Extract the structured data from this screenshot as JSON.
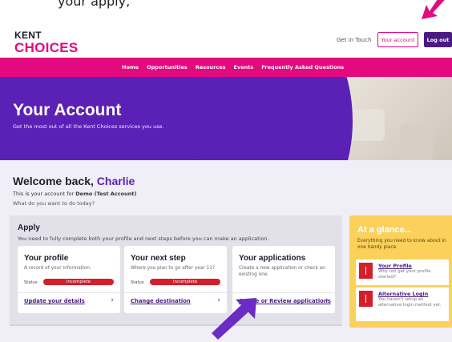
{
  "clipped_text": "your apply,",
  "header": {
    "logo_line1": "KENT",
    "logo_line2": "CHOICES",
    "get_in_touch": "Get in Touch",
    "your_account": "Your account",
    "log_out": "Log out"
  },
  "nav": {
    "items": [
      "Home",
      "Opportunities",
      "Resources",
      "Events",
      "Frequently Asked Questions"
    ]
  },
  "hero": {
    "title": "Your Account",
    "subtitle": "Get the most out of all the Kent Choices services you use."
  },
  "welcome": {
    "prefix": "Welcome back, ",
    "name": "Charlie",
    "account_prefix": "This is your account for ",
    "account_name": "Demo (Test Account)",
    "question": "What do you want to do today?"
  },
  "apply": {
    "title": "Apply",
    "description": "You need to fully complete both your profile and next steps before you can make an application.",
    "cards": [
      {
        "title": "Your profile",
        "description": "A record of your information.",
        "status_label": "Status",
        "status_value": "Incomplete",
        "link": "Update your details"
      },
      {
        "title": "Your next step",
        "description": "Where you plan to go after year 11?",
        "status_label": "Status",
        "status_value": "Incomplete",
        "link": "Change destination"
      },
      {
        "title": "Your applications",
        "description": "Create a new application or check an existing one.",
        "link": "Create or Review applications"
      }
    ]
  },
  "glance": {
    "title": "At a glance...",
    "description": "Everything you need to know about in one handy place.",
    "items": [
      {
        "link": "Your Profile",
        "text": "Why not get your profile started?"
      },
      {
        "link": "Alternative Login",
        "text": "You haven't setup an alternative login method yet."
      }
    ]
  },
  "colors": {
    "brand_pink": "#e3097f",
    "brand_purple": "#5b21b6",
    "status_red": "#d31f2b",
    "glance_yellow": "#fbd15b",
    "arrow_top": "#e3097f",
    "arrow_bottom": "#6b2bc4"
  },
  "icons": {
    "chevron": "chevron-right-icon",
    "flag": "red-flag-icon",
    "arrows": "pointer-arrow-icon"
  }
}
